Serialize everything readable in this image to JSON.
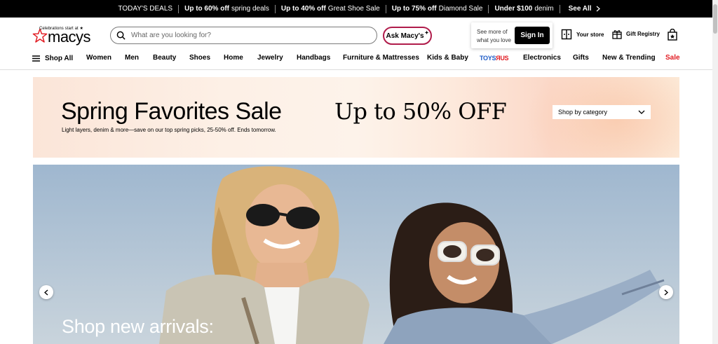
{
  "promo_bar": {
    "items": [
      {
        "bold": "",
        "text": "TODAY'S DEALS"
      },
      {
        "bold": "Up to 60% off",
        "text": "spring deals"
      },
      {
        "bold": "Up to 40% off",
        "text": "Great Shoe Sale"
      },
      {
        "bold": "Up to 75% off",
        "text": "Diamond Sale"
      },
      {
        "bold": "Under $100",
        "text": "denim"
      }
    ],
    "see_all": "See All"
  },
  "header": {
    "logo_tagline": "Celebrations start at ★",
    "logo_word": "macys",
    "search_placeholder": "What are you looking for?",
    "ask_label": "Ask Macy's",
    "signin_prompt_line1": "See more of",
    "signin_prompt_line2": "what you love",
    "signin_label": "Sign In",
    "your_store": "Your store",
    "gift_registry": "Gift Registry"
  },
  "nav": {
    "shop_all": "Shop All",
    "items": [
      "Women",
      "Men",
      "Beauty",
      "Shoes",
      "Home",
      "Jewelry",
      "Handbags",
      "Furniture & Mattresses",
      "Kids & Baby"
    ],
    "toys": "TOYS R US",
    "items_after": [
      "Electronics",
      "Gifts",
      "New & Trending"
    ],
    "sale": "Sale"
  },
  "banner": {
    "title": "Spring Favorites Sale",
    "offer": "Up to 50% OFF",
    "subtitle": "Light layers, denim & more—save on our top spring picks, 25-50% off. Ends tomorrow.",
    "shop_by_category": "Shop by category"
  },
  "hero": {
    "title": "Shop new arrivals:"
  },
  "colors": {
    "brand_red": "#e11b22",
    "ask_border": "#b01c4b",
    "black": "#000000"
  }
}
